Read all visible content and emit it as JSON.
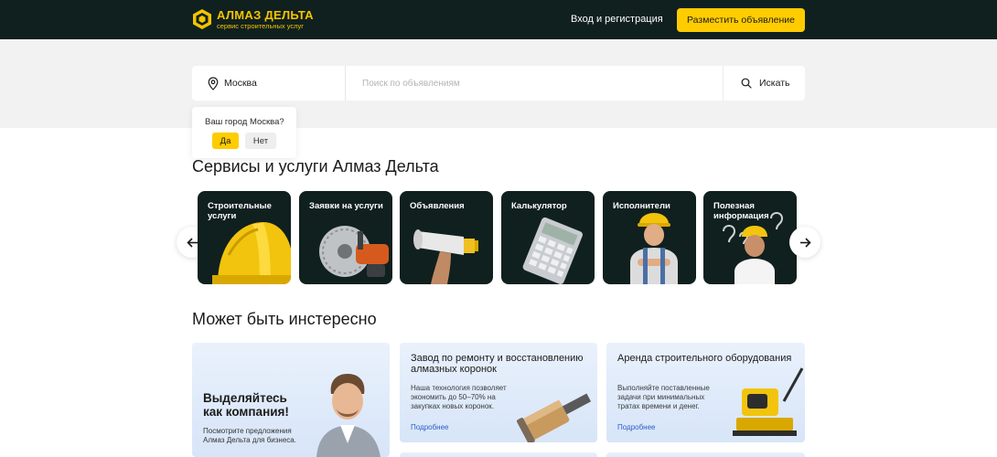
{
  "header": {
    "brand_name": "АЛМАЗ ДЕЛЬТА",
    "brand_tagline": "сервис строительных услуг",
    "login_label": "Вход и регистрация",
    "post_ad_label": "Разместить объявление",
    "brand_color": "#f5c400",
    "bg_color": "#10201f"
  },
  "search": {
    "city": "Москва",
    "placeholder": "Поиск по объявлениям",
    "button_label": "Искать"
  },
  "city_popup": {
    "question": "Ваш город Москва?",
    "yes_label": "Да",
    "no_label": "Нет"
  },
  "services": {
    "title": "Сервисы и услуги Алмаз Дельта",
    "cards": [
      {
        "label": "Строительные услуги",
        "icon": "hard-hat-icon"
      },
      {
        "label": "Заявки на услуги",
        "icon": "circular-saw-icon"
      },
      {
        "label": "Объявления",
        "icon": "megaphone-icon"
      },
      {
        "label": "Калькулятор",
        "icon": "calculator-icon"
      },
      {
        "label": "Исполнители",
        "icon": "worker-icon"
      },
      {
        "label": "Полезная информация",
        "icon": "question-marks-icon"
      }
    ]
  },
  "interesting": {
    "title": "Может быть инстересно",
    "business": {
      "heading": "Выделяйтесь как компания!",
      "text": "Посмотрите предложения Алмаз Дельта для бизнеса."
    },
    "promos": [
      {
        "title": "Завод по ремонту и восстановлению алмазных коронок",
        "text": "Наша технология позволяет экономить до 50–70% на закупках новых коронок.",
        "link": "Подробнее"
      },
      {
        "title": "Аренда строительного оборудования",
        "text": "Выполняйте поставленные задачи при минимальных тратах времени и денег.",
        "link": "Подробнее"
      }
    ]
  },
  "accent_color": "#ffcc00"
}
